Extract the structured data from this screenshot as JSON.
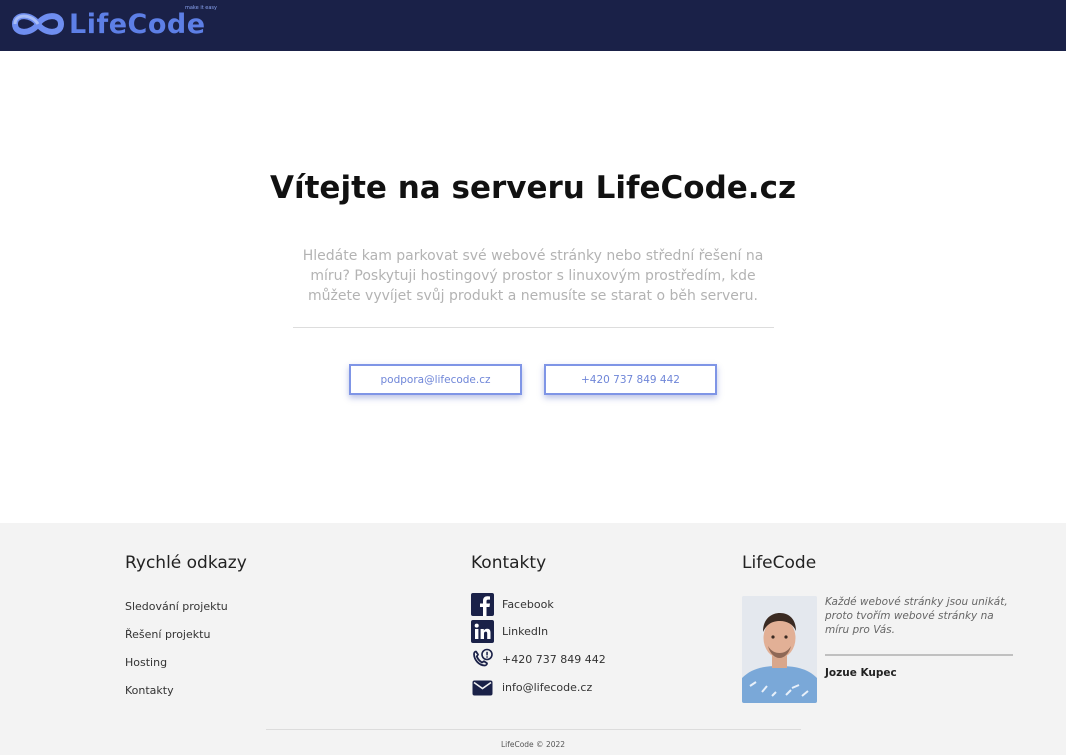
{
  "header": {
    "logo_text": "LifeCode",
    "logo_tagline": "make it easy",
    "logo_icon": "infinity-icon",
    "background": "#1a2148",
    "accent": "#5d7fe6"
  },
  "hero": {
    "title": "Vítejte na serveru LifeCode.cz",
    "text": "Hledáte kam parkovat své webové stránky nebo střední řešení na míru? Poskytuji hostingový prostor s linuxovým prostředím, kde můžete vyvíjet svůj produkt a nemusíte se starat o běh serveru.",
    "buttons": [
      {
        "label": "podpora@lifecode.cz"
      },
      {
        "label": "+420 737 849 442"
      }
    ]
  },
  "footer": {
    "quick_links": {
      "title": "Rychlé odkazy",
      "items": [
        {
          "label": "Sledování projektu"
        },
        {
          "label": "Řešení projektu"
        },
        {
          "label": "Hosting"
        },
        {
          "label": "Kontakty"
        }
      ]
    },
    "contacts": {
      "title": "Kontakty",
      "items": [
        {
          "icon": "facebook-icon",
          "label": "Facebook"
        },
        {
          "icon": "linkedin-icon",
          "label": "LinkedIn"
        },
        {
          "icon": "phone-icon",
          "label": "+420 737 849 442"
        },
        {
          "icon": "mail-icon",
          "label": "info@lifecode.cz"
        }
      ]
    },
    "about": {
      "title": "LifeCode",
      "quote": "Každé webové stránky jsou unikát, proto tvořím webové stránky na míru pro Vás.",
      "author": "Jozue Kupec"
    },
    "copyright": "LifeCode © 2022"
  }
}
